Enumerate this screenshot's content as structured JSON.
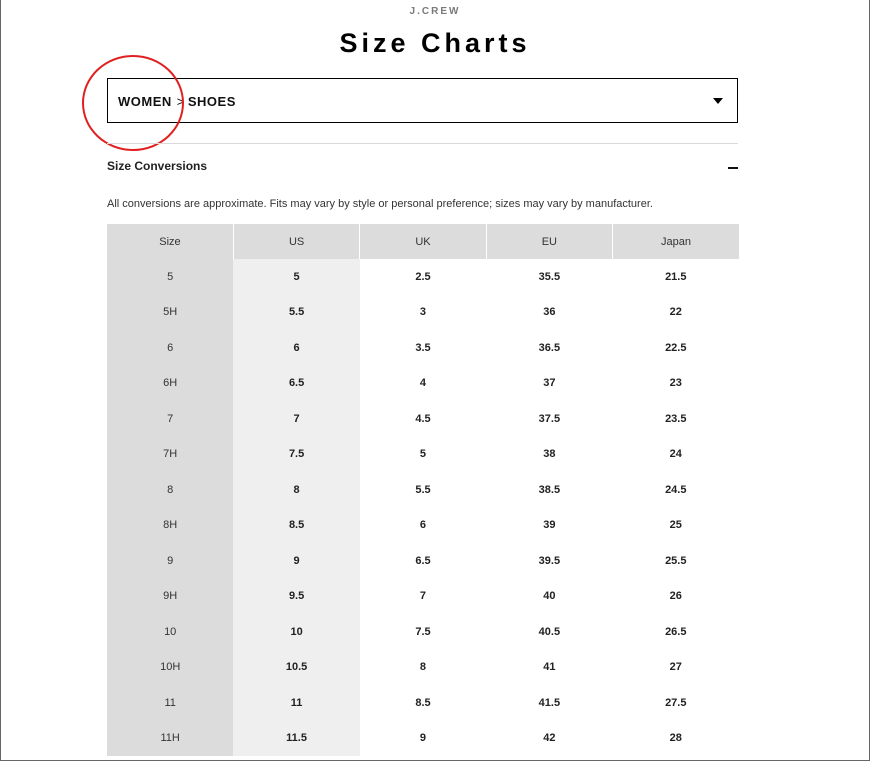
{
  "header": {
    "brand": "J.CREW",
    "title": "Size Charts"
  },
  "selector": {
    "crumb_category": "WOMEN",
    "crumb_separator": ">",
    "crumb_subcategory": "SHOES"
  },
  "section": {
    "title": "Size Conversions",
    "note": "All conversions are approximate. Fits may vary by style or personal preference; sizes may vary by manufacturer."
  },
  "colors": {
    "highlight": "#e02020",
    "header_bg": "#dcdcdc",
    "us_column_bg": "#efefef"
  },
  "table": {
    "headers": [
      "Size",
      "US",
      "UK",
      "EU",
      "Japan"
    ],
    "rows": [
      [
        "5",
        "5",
        "2.5",
        "35.5",
        "21.5"
      ],
      [
        "5H",
        "5.5",
        "3",
        "36",
        "22"
      ],
      [
        "6",
        "6",
        "3.5",
        "36.5",
        "22.5"
      ],
      [
        "6H",
        "6.5",
        "4",
        "37",
        "23"
      ],
      [
        "7",
        "7",
        "4.5",
        "37.5",
        "23.5"
      ],
      [
        "7H",
        "7.5",
        "5",
        "38",
        "24"
      ],
      [
        "8",
        "8",
        "5.5",
        "38.5",
        "24.5"
      ],
      [
        "8H",
        "8.5",
        "6",
        "39",
        "25"
      ],
      [
        "9",
        "9",
        "6.5",
        "39.5",
        "25.5"
      ],
      [
        "9H",
        "9.5",
        "7",
        "40",
        "26"
      ],
      [
        "10",
        "10",
        "7.5",
        "40.5",
        "26.5"
      ],
      [
        "10H",
        "10.5",
        "8",
        "41",
        "27"
      ],
      [
        "11",
        "11",
        "8.5",
        "41.5",
        "27.5"
      ],
      [
        "11H",
        "11.5",
        "9",
        "42",
        "28"
      ]
    ]
  }
}
